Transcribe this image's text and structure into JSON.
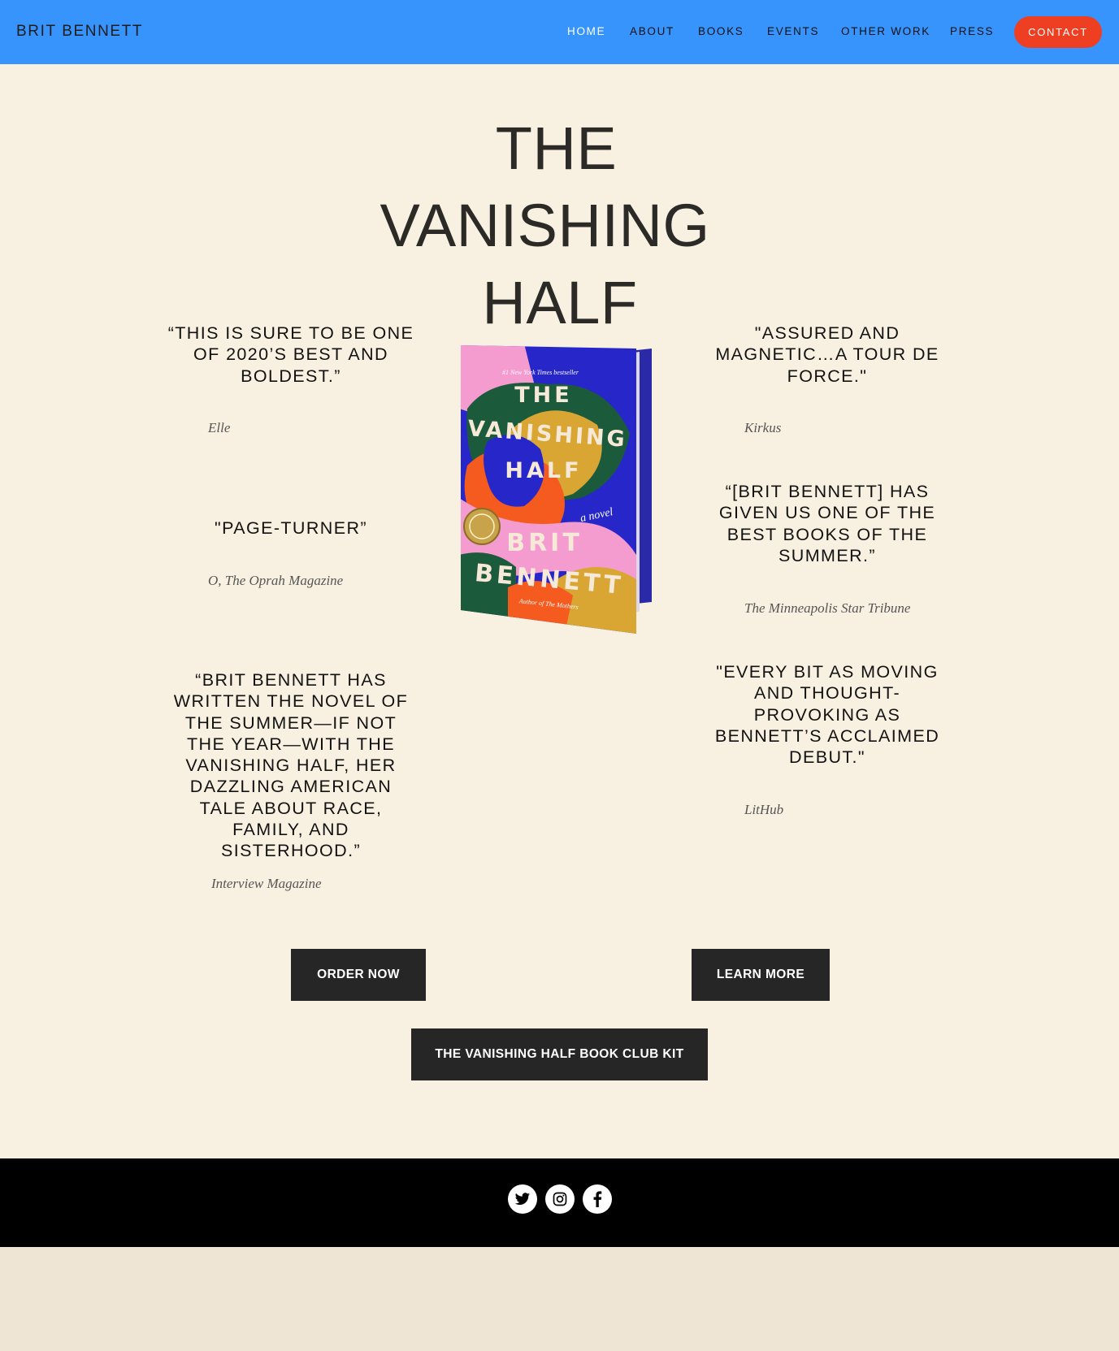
{
  "header": {
    "brand": "BRIT BENNETT",
    "nav": [
      "HOME",
      "ABOUT",
      "BOOKS",
      "EVENTS",
      "OTHER WORK",
      "PRESS"
    ],
    "contact": "CONTACT"
  },
  "hero": {
    "title_lines": [
      "THE",
      "VANISHING",
      "HALF"
    ]
  },
  "book_cover": {
    "badge": "#1 New York Times bestseller",
    "title_lines": [
      "THE",
      "VANISHING",
      "HALF"
    ],
    "subtitle": "a novel",
    "author_lines": [
      "BRIT",
      "BENNETT"
    ],
    "byline": "Author of The Mothers"
  },
  "quotes": {
    "left": [
      {
        "text": "“THIS IS SURE TO BE ONE OF 2020’S BEST AND BOLDEST.”",
        "source": "Elle"
      },
      {
        "text": "\"PAGE-TURNER”",
        "source": "O, The Oprah Magazine"
      },
      {
        "text": "“BRIT BENNETT HAS WRITTEN THE NOVEL OF THE SUMMER—IF NOT THE YEAR—WITH THE VANISHING HALF, HER DAZZLING AMERICAN TALE ABOUT RACE, FAMILY, AND SISTERHOOD.”",
        "source": "Interview Magazine"
      }
    ],
    "right": [
      {
        "text": "\"ASSURED AND MAGNETIC…A TOUR DE FORCE.\"",
        "source": "Kirkus"
      },
      {
        "text": "“[BRIT BENNETT] HAS GIVEN US ONE OF THE BEST BOOKS OF THE SUMMER.”",
        "source": "The Minneapolis Star Tribune"
      },
      {
        "text": "\"EVERY BIT AS MOVING AND THOUGHT-PROVOKING AS BENNETT’S ACCLAIMED DEBUT.\"",
        "source": "LitHub"
      }
    ]
  },
  "buttons": {
    "order": "ORDER NOW",
    "learn": "LEARN MORE",
    "kit": "THE VANISHING HALF BOOK CLUB KIT"
  },
  "footer": {
    "social_icons": [
      "twitter-icon",
      "instagram-icon",
      "facebook-icon"
    ]
  },
  "colors": {
    "nav_bg": "#3794fc",
    "contact_bg": "#ef3f23",
    "page_bg": "#f8f1e1",
    "button_bg": "#262626",
    "footer_bg": "#000000"
  }
}
